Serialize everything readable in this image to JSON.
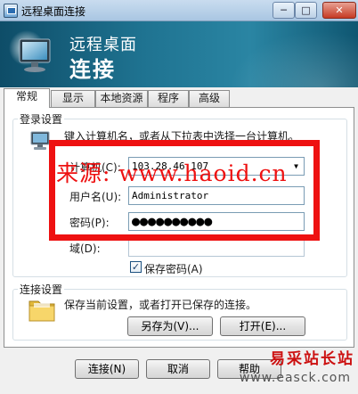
{
  "window": {
    "title": "远程桌面连接",
    "controls": {
      "minimize": "─",
      "maximize": "□",
      "close": "✕"
    }
  },
  "banner": {
    "line1": "远程桌面",
    "line2": "连接"
  },
  "tabs": [
    {
      "label": "常规",
      "active": true
    },
    {
      "label": "显示",
      "active": false
    },
    {
      "label": "本地资源",
      "active": false
    },
    {
      "label": "程序",
      "active": false
    },
    {
      "label": "高级",
      "active": false
    }
  ],
  "login": {
    "group_title": "登录设置",
    "instruction": "键入计算机名，或者从下拉表中选择一台计算机。",
    "computer_label": "计算机(C):",
    "computer_value": "103.28.46.107",
    "username_label": "用户名(U):",
    "username_value": "Administrator",
    "password_label": "密码(P):",
    "password_value": "●●●●●●●●●●",
    "domain_label": "域(D):",
    "domain_value": "",
    "save_password_label": "保存密码(A)",
    "save_password_checked": true
  },
  "connection": {
    "group_title": "连接设置",
    "description": "保存当前设置，或者打开已保存的连接。",
    "save_as_label": "另存为(V)...",
    "open_label": "打开(E)..."
  },
  "footer": {
    "connect_label": "连接(N)",
    "cancel_label": "取消",
    "help_label": "帮助"
  },
  "overlay": {
    "watermark": "来源: www.haoid.cn",
    "corner_site": "易采站长站",
    "corner_url": "www.easck.com"
  },
  "colors": {
    "banner_dark": "#0e4d68",
    "banner_light": "#2a85a3",
    "highlight_red": "#ee1111"
  }
}
